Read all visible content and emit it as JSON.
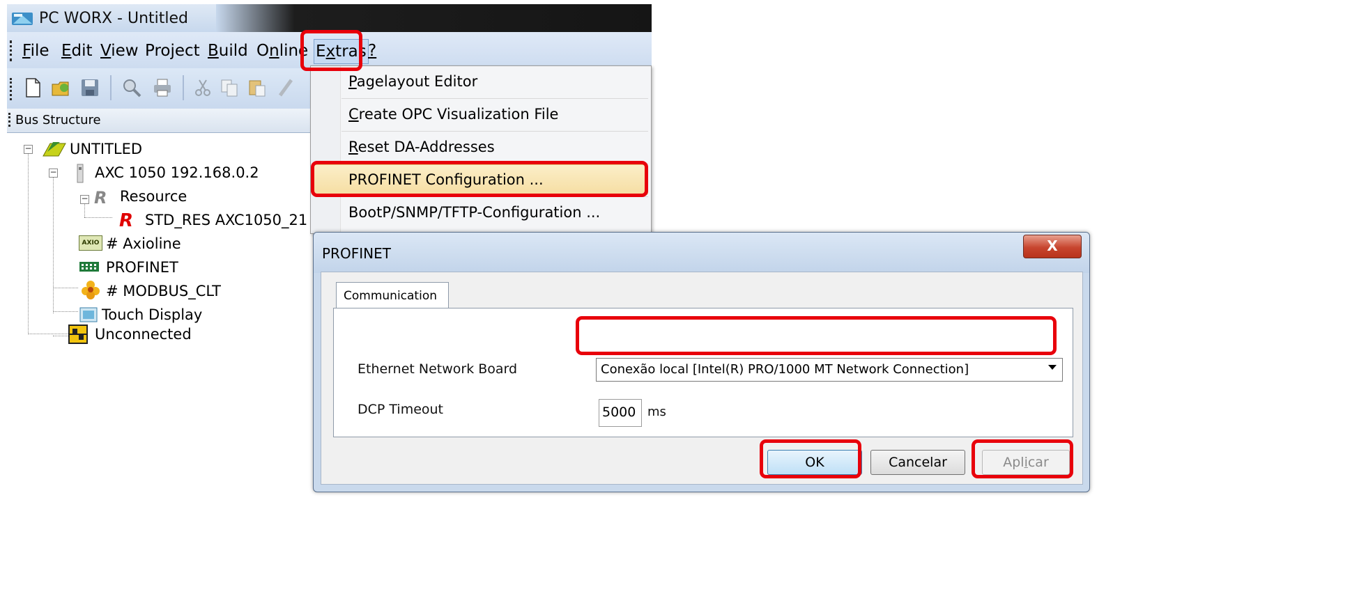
{
  "window": {
    "title": "PC WORX - Untitled"
  },
  "menu": {
    "items": [
      {
        "pre": "",
        "u": "F",
        "post": "ile"
      },
      {
        "pre": "",
        "u": "E",
        "post": "dit"
      },
      {
        "pre": "",
        "u": "V",
        "post": "iew"
      },
      {
        "pre": "Pro",
        "u": "j",
        "post": "ect"
      },
      {
        "pre": "",
        "u": "B",
        "post": "uild"
      },
      {
        "pre": "O",
        "u": "n",
        "post": "line"
      },
      {
        "pre": "E",
        "u": "x",
        "post": "tras"
      },
      {
        "pre": "",
        "u": "?",
        "post": ""
      }
    ]
  },
  "bus_structure": {
    "header": "Bus Structure",
    "nodes": [
      {
        "label": "UNTITLED",
        "icon": "project-icon"
      },
      {
        "label": "AXC 1050 192.168.0.2",
        "icon": "controller-icon"
      },
      {
        "label": "Resource",
        "icon": "resource-icon",
        "icon_text": "R"
      },
      {
        "label": "STD_RES AXC1050_21",
        "icon": "std-resource-icon",
        "icon_text": "R"
      },
      {
        "label": "# Axioline",
        "icon": "axioline-icon",
        "icon_text": "AXIO"
      },
      {
        "label": "PROFINET",
        "icon": "profinet-icon"
      },
      {
        "label": "# MODBUS_CLT",
        "icon": "modbus-icon"
      },
      {
        "label": "Touch Display",
        "icon": "touch-display-icon"
      },
      {
        "label": "Unconnected",
        "icon": "unconnected-icon"
      }
    ]
  },
  "extras_menu": {
    "items": [
      {
        "u": "P",
        "rest": "agelayout Editor"
      },
      {
        "u": "C",
        "rest": "reate OPC Visualization File"
      },
      {
        "u": "R",
        "rest": "eset DA-Addresses"
      },
      {
        "u": "",
        "rest": "PROFINET Configuration ..."
      },
      {
        "u": "",
        "rest": "BootP/SNMP/TFTP-Configuration ..."
      }
    ],
    "highlighted_index": 3
  },
  "dialog": {
    "title": "PROFINET",
    "close_glyph": "X",
    "tab": "Communication",
    "ethernet_label": "Ethernet Network Board",
    "ethernet_value": "Conexão local [Intel(R) PRO/1000 MT Network Connection]",
    "dcp_label": "DCP Timeout",
    "dcp_value": "5000",
    "dcp_unit": "ms",
    "ok": "OK",
    "cancel": "Cancelar",
    "apply_pre": "Apl",
    "apply_u": "i",
    "apply_post": "car"
  },
  "colors": {
    "annotation": "#e8000b",
    "menu_highlight": "#f6dea3",
    "title_bar": "#c7d8ed"
  }
}
